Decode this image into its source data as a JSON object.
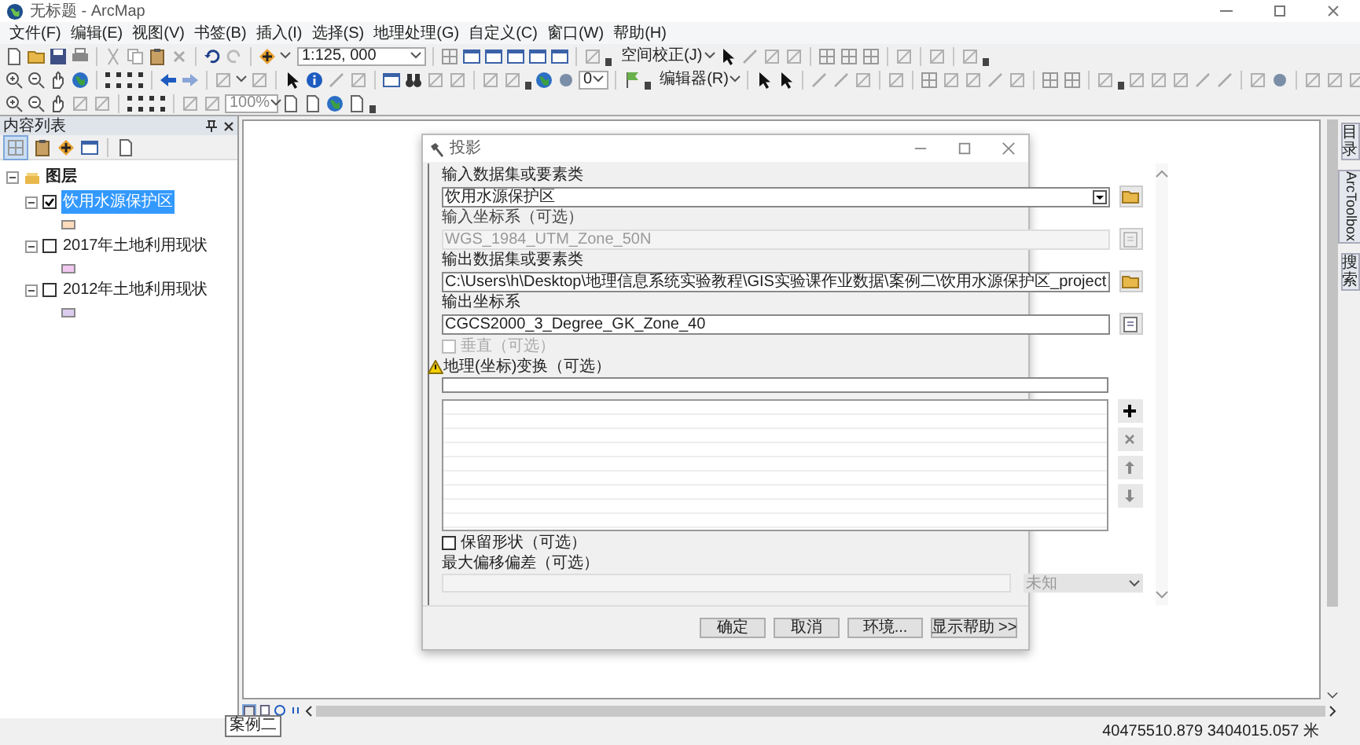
{
  "window": {
    "title": "无标题 - ArcMap"
  },
  "menu": [
    "文件(F)",
    "编辑(E)",
    "视图(V)",
    "书签(B)",
    "插入(I)",
    "选择(S)",
    "地理处理(G)",
    "自定义(C)",
    "窗口(W)",
    "帮助(H)"
  ],
  "toolbar": {
    "scale": "1:125, 000",
    "spatial_adjustment": "空间校正(J)",
    "angle": "0",
    "editor": "编辑器(R)",
    "zoom": "100%"
  },
  "toc": {
    "title": "内容列表",
    "root": {
      "label": "图层",
      "expanded": true,
      "children": [
        {
          "label": "饮用水源保护区",
          "checked": true,
          "selected": true,
          "expanded": true,
          "color": "#fcdcbc"
        },
        {
          "label": "2017年土地利用现状",
          "checked": false,
          "selected": false,
          "expanded": true,
          "color": "#f2c8f0"
        },
        {
          "label": "2012年土地利用现状",
          "checked": false,
          "selected": false,
          "expanded": true,
          "color": "#dccdf0"
        }
      ]
    }
  },
  "dialog": {
    "title": "投影",
    "params": [
      {
        "kind": "field",
        "label": "输入数据集或要素类",
        "value": "饮用水源保护区",
        "dropdown": true,
        "disabled": false,
        "browse_folder": true
      },
      {
        "kind": "field",
        "label": "输入坐标系（可选）",
        "value": "WGS_1984_UTM_Zone_50N",
        "dropdown": false,
        "disabled": true,
        "browse_folder": false
      },
      {
        "kind": "field",
        "label": "输出数据集或要素类",
        "value": "C:\\Users\\h\\Desktop\\地理信息系统实验教程\\GIS实验课作业数据\\案例二\\饮用水源保护区_project",
        "dropdown": false,
        "disabled": false,
        "browse_folder": true
      },
      {
        "kind": "field",
        "label": "输出坐标系",
        "value": "CGCS2000_3_Degree_GK_Zone_40",
        "dropdown": false,
        "disabled": false,
        "browse_folder": false
      },
      {
        "kind": "checkbox",
        "label": "垂直（可选）",
        "checked": false,
        "disabled": true
      },
      {
        "kind": "list",
        "label": "地理(坐标)变换（可选）",
        "warning": true
      },
      {
        "kind": "checkbox",
        "label": "保留形状（可选）",
        "checked": false,
        "disabled": false
      },
      {
        "kind": "unit",
        "label": "最大偏移偏差（可选）",
        "unit": "未知",
        "disabled": true
      }
    ],
    "buttons": [
      "确定",
      "取消",
      "环境...",
      "显示帮助 >>"
    ]
  },
  "side_tabs": [
    "目录",
    "ArcToolbox",
    "搜索"
  ],
  "tooltip": "案例二",
  "status": {
    "coordinates": "40475510.879  3404015.057 米"
  }
}
